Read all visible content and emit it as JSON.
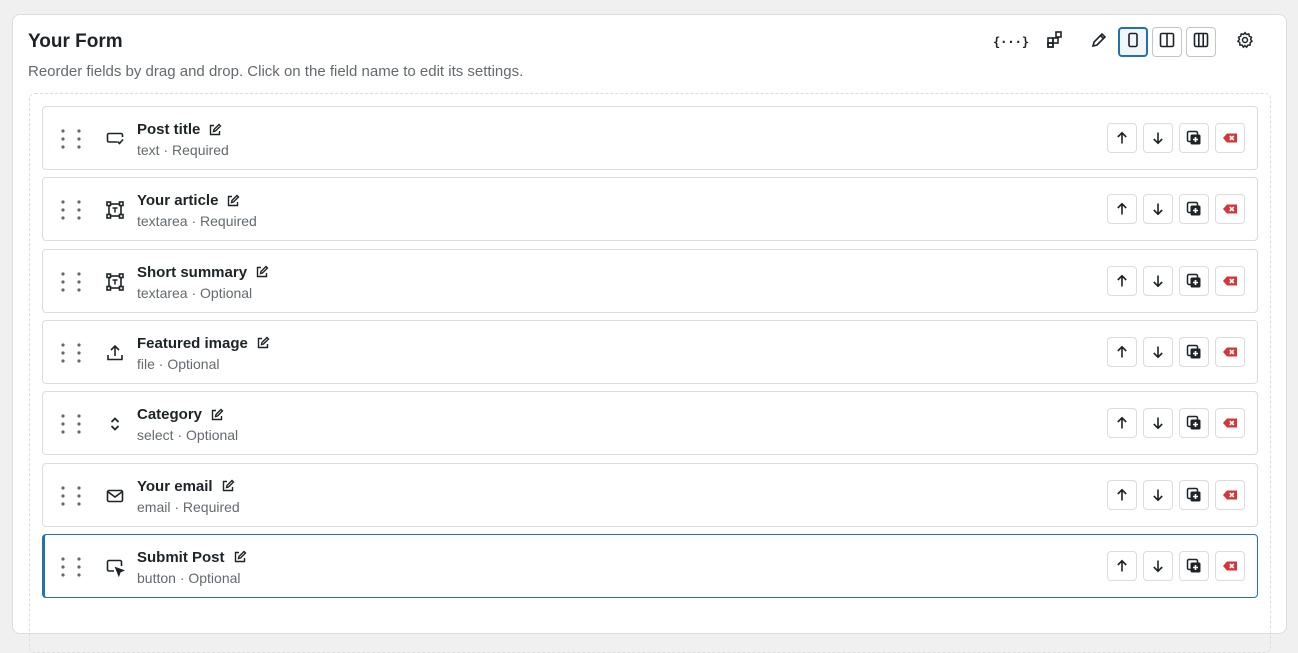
{
  "form": {
    "title": "Your Form",
    "subtitle": "Reorder fields by drag and drop. Click on the field name to edit its settings."
  },
  "toolbar": {
    "variables_label": "{···}",
    "icons": [
      "variables-icon",
      "add-block-icon",
      "pencil-icon",
      "single-column-icon",
      "two-column-icon",
      "three-column-icon",
      "settings-gear-icon"
    ],
    "active": "single-column"
  },
  "colors": {
    "accent": "#2271b1",
    "danger": "#d63638",
    "muted": "#646970",
    "border": "#dcdcde"
  },
  "fields": [
    {
      "name": "Post title",
      "meta": "text · Required",
      "icon": "text-input-icon",
      "selected": false
    },
    {
      "name": "Your article",
      "meta": "textarea · Required",
      "icon": "textarea-icon",
      "selected": false
    },
    {
      "name": "Short summary",
      "meta": "textarea · Optional",
      "icon": "textarea-icon",
      "selected": false
    },
    {
      "name": "Featured image",
      "meta": "file · Optional",
      "icon": "upload-icon",
      "selected": false
    },
    {
      "name": "Category",
      "meta": "select · Optional",
      "icon": "select-chevrons-icon",
      "selected": false
    },
    {
      "name": "Your email",
      "meta": "email · Required",
      "icon": "envelope-icon",
      "selected": false
    },
    {
      "name": "Submit Post",
      "meta": "button · Optional",
      "icon": "button-cursor-icon",
      "selected": true
    }
  ],
  "row_actions": [
    "move-up-icon",
    "move-down-icon",
    "duplicate-icon",
    "delete-icon"
  ]
}
